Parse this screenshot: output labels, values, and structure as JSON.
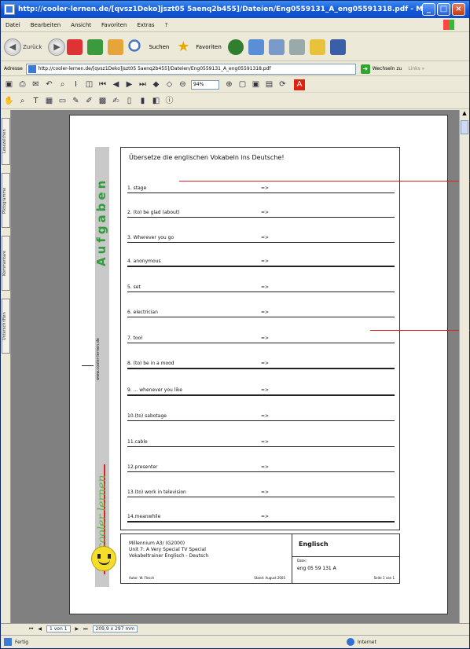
{
  "window": {
    "title": "http://cooler-lernen.de/[qvsz1Deko]jszt05 5aenq2b455]/Dateien/Eng0559131_A_eng05591318.pdf - M...",
    "min": "_",
    "max": "□",
    "close": "×"
  },
  "menu": [
    "Datei",
    "Bearbeiten",
    "Ansicht",
    "Favoriten",
    "Extras",
    "?"
  ],
  "toolbar": {
    "back": "Zurück",
    "search": "Suchen",
    "favorites": "Favoriten"
  },
  "address": {
    "label": "Adresse",
    "url": "http://cooler-lernen.de/[qvsz1Deko]jszt05 5aenq2b455]/Dateien/Eng0559131_A_eng05591318.pdf",
    "go": "Wechseln zu",
    "links": "Links »"
  },
  "pdf": {
    "zoom": "94%"
  },
  "sidetabs": [
    "Lesezeichen",
    "Piktogramme",
    "Kommentare",
    "Unterschriften"
  ],
  "worksheet": {
    "band_text": "Aufgaben",
    "site": "www.cooler-lernen.de",
    "logo_text": "cooler lernen",
    "heading": "Übersetze die englischen Vokabeln ins Deutsche!",
    "arrow": "=>",
    "items": [
      "1. stage",
      "2. (to) be glad (about)",
      "3. Wherever you go",
      "4. anonymous",
      "5. set",
      "6. electrician",
      "7. tool",
      "8. (to) be in a mood",
      "9. ... whenever you like",
      "10.(to) sabotage",
      "11.cable",
      "12.presenter",
      "13.(to) work in television",
      "14.meanwhile"
    ],
    "footer": {
      "line1": "Millennium A3/ (G2000)",
      "line2": "Unit 7: A Very Special TV Special",
      "line3": "Vokabeltrainer Englisch - Deutsch",
      "author": "Autor: W. Flesch",
      "stand": "Stand: August 2005",
      "subject": "Englisch",
      "datei_label": "Datei:",
      "datei": "eng 05 59 131 A",
      "seite": "Seite 1 von 1"
    }
  },
  "pagenav": {
    "page": "1 von 1",
    "size": "209,9 x 297 mm"
  },
  "status": {
    "left": "Fertig",
    "zone": "Internet"
  }
}
